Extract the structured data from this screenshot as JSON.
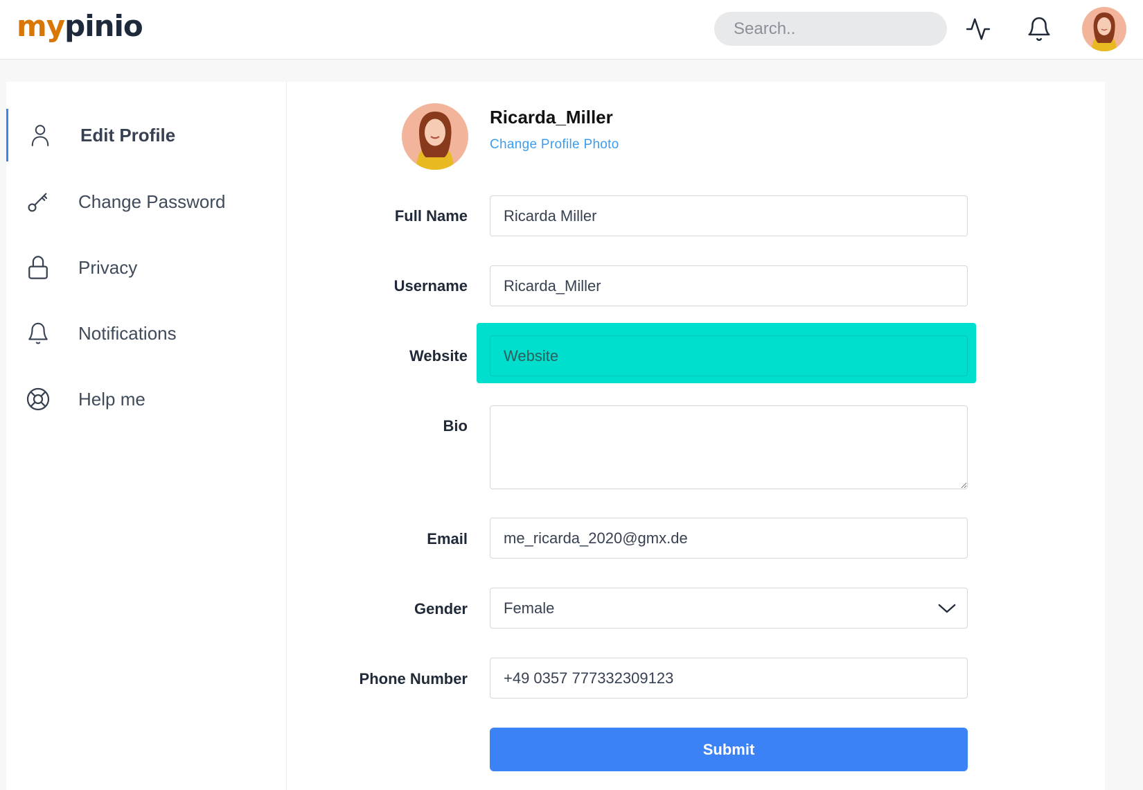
{
  "header": {
    "logo_part1": "my",
    "logo_part2": "pinio",
    "search_placeholder": "Search..",
    "icons": [
      "activity-icon",
      "bell-icon"
    ],
    "avatar": "user-avatar"
  },
  "sidebar": {
    "items": [
      {
        "label": "Edit Profile",
        "icon": "user-icon",
        "active": true
      },
      {
        "label": "Change Password",
        "icon": "key-icon",
        "active": false
      },
      {
        "label": "Privacy",
        "icon": "lock-icon",
        "active": false
      },
      {
        "label": "Notifications",
        "icon": "bell-icon",
        "active": false
      },
      {
        "label": "Help me",
        "icon": "lifebuoy-icon",
        "active": false
      }
    ]
  },
  "profile": {
    "username": "Ricarda_Miller",
    "change_photo_label": "Change Profile Photo"
  },
  "form": {
    "full_name_label": "Full Name",
    "full_name_value": "Ricarda Miller",
    "username_label": "Username",
    "username_value": "Ricarda_Miller",
    "website_label": "Website",
    "website_placeholder": "Website",
    "bio_label": "Bio",
    "bio_value": "",
    "email_label": "Email",
    "email_value": "me_ricarda_2020@gmx.de",
    "gender_label": "Gender",
    "gender_value": "Female",
    "phone_label": "Phone Number",
    "phone_value": "+49 0357 777332309123",
    "submit_label": "Submit"
  },
  "colors": {
    "accent": "#3b82f6",
    "highlight": "#00dfce",
    "logo_orange": "#d97706",
    "logo_dark": "#1e293b",
    "link": "#3b9cf0"
  }
}
